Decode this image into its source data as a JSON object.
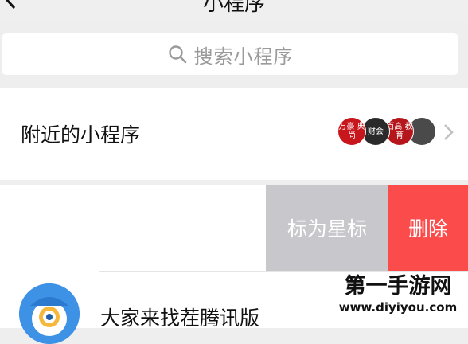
{
  "header": {
    "title": "小程序",
    "back_icon": "chevron-left-icon"
  },
  "search": {
    "placeholder": "搜索小程序",
    "icon": "search-icon"
  },
  "nearby": {
    "label": "附近的小程序",
    "thumbnails": [
      {
        "text": "万豪 典尚",
        "color": "#c8161d"
      },
      {
        "text": "财会",
        "color": "#2a2a2a"
      },
      {
        "text": "百高 教育",
        "color": "#b5161b"
      },
      {
        "text": "",
        "color": "#4a4a4a"
      }
    ],
    "chevron_icon": "chevron-right-icon"
  },
  "swipe_actions": {
    "star_label": "标为星标",
    "delete_label": "删除"
  },
  "list": {
    "items": [
      {
        "title": "大家来找茬腾讯版",
        "icon": "app-icon"
      }
    ]
  },
  "watermark": {
    "title": "第一手游网",
    "url": "www.diyiyou.com"
  },
  "colors": {
    "delete": "#fc4b4b",
    "star": "#c7c7cc",
    "background": "#eeeeee"
  }
}
